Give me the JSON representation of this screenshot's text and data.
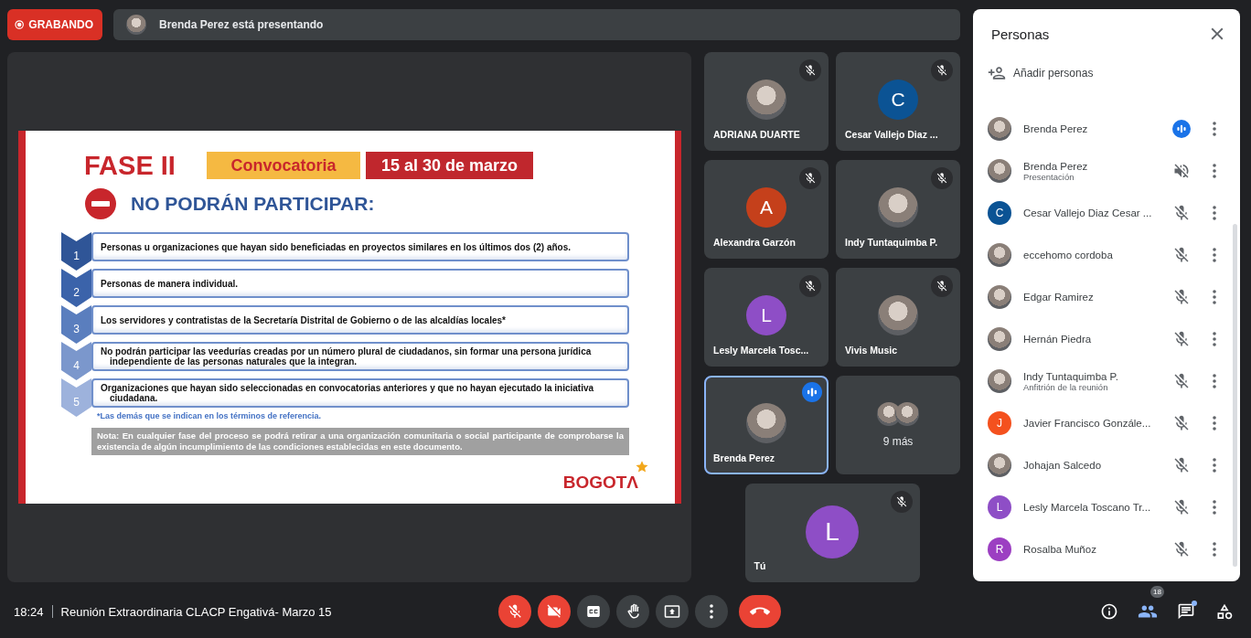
{
  "recording": {
    "label": "GRABANDO"
  },
  "presenting": {
    "text": "Brenda Perez está presentando"
  },
  "slide": {
    "phase": "FASE II",
    "tag": "Convocatoria",
    "date_range": "15 al 30 de marzo",
    "heading": "NO PODRÁN PARTICIPAR:",
    "items": [
      {
        "number": "1",
        "text": "Personas u organizaciones que hayan sido beneficiadas en proyectos similares en los últimos dos (2) años."
      },
      {
        "number": "2",
        "text": "Personas de manera individual."
      },
      {
        "number": "3",
        "text": "Los servidores y contratistas de la Secretaría Distrital de Gobierno o de las alcaldías locales*"
      },
      {
        "number": "4",
        "text": "No podrán participar las veedurías creadas por un número plural de ciudadanos, sin formar una persona jurídica independiente de las personas naturales que la integran."
      },
      {
        "number": "5",
        "text": "Organizaciones que hayan sido seleccionadas en convocatorias anteriores y que no hayan ejecutado la iniciativa ciudadana."
      }
    ],
    "footnote": "*Las demás que se indican en los términos de referencia.",
    "note": "Nota: En cualquier fase del proceso se podrá retirar a una organización comunitaria o social participante de comprobarse la existencia de algún incumplimiento de las condiciones establecidas en este documento.",
    "logo_text": "BOGOTΛ"
  },
  "tiles": [
    {
      "name": "ADRIANA DUARTE",
      "avatar": {
        "kind": "photo"
      },
      "muted": true,
      "speaking": false
    },
    {
      "name": "Cesar Vallejo Diaz ...",
      "avatar": {
        "kind": "letter",
        "letter": "C",
        "color": "#0b5394"
      },
      "muted": true,
      "speaking": false
    },
    {
      "name": "Alexandra Garzón",
      "avatar": {
        "kind": "letter",
        "letter": "A",
        "color": "#c5401b"
      },
      "muted": true,
      "speaking": false
    },
    {
      "name": "Indy Tuntaquimba P.",
      "avatar": {
        "kind": "photo"
      },
      "muted": true,
      "speaking": false
    },
    {
      "name": "Lesly Marcela Tosc...",
      "avatar": {
        "kind": "letter",
        "letter": "L",
        "color": "#8e4ec6"
      },
      "muted": true,
      "speaking": false
    },
    {
      "name": "Vivis Music",
      "avatar": {
        "kind": "photo"
      },
      "muted": true,
      "speaking": false
    },
    {
      "name": "Brenda Perez",
      "avatar": {
        "kind": "photo"
      },
      "muted": false,
      "speaking": true
    }
  ],
  "more_tile": {
    "label": "9 más"
  },
  "self_tile": {
    "name": "Tú",
    "letter": "L",
    "color": "#8e4ec6",
    "muted": true
  },
  "people_panel": {
    "title": "Personas",
    "add_label": "Añadir personas",
    "people": [
      {
        "name": "Brenda Perez",
        "avatar": {
          "kind": "photo"
        },
        "status": {
          "kind": "speaking"
        }
      },
      {
        "name": "Brenda Perez",
        "subtitle": "Presentación",
        "avatar": {
          "kind": "photo"
        },
        "status": {
          "kind": "speakeroff"
        }
      },
      {
        "name": "Cesar Vallejo Diaz Cesar ...",
        "avatar": {
          "kind": "letter",
          "letter": "C",
          "color": "#0b5394"
        },
        "status": {
          "kind": "muted"
        }
      },
      {
        "name": "eccehomo cordoba",
        "avatar": {
          "kind": "photo"
        },
        "status": {
          "kind": "muted"
        }
      },
      {
        "name": "Edgar Ramirez",
        "avatar": {
          "kind": "photo"
        },
        "status": {
          "kind": "muted"
        }
      },
      {
        "name": "Hernán Piedra",
        "avatar": {
          "kind": "photo"
        },
        "status": {
          "kind": "muted"
        }
      },
      {
        "name": "Indy Tuntaquimba P.",
        "subtitle": "Anfitrión de la reunión",
        "avatar": {
          "kind": "photo"
        },
        "status": {
          "kind": "muted"
        }
      },
      {
        "name": "Javier Francisco Gonzále...",
        "avatar": {
          "kind": "letter",
          "letter": "J",
          "color": "#f4511e"
        },
        "status": {
          "kind": "muted"
        }
      },
      {
        "name": "Johajan Salcedo",
        "avatar": {
          "kind": "photo"
        },
        "status": {
          "kind": "muted"
        }
      },
      {
        "name": "Lesly Marcela Toscano Tr...",
        "avatar": {
          "kind": "letter",
          "letter": "L",
          "color": "#8e4ec6"
        },
        "status": {
          "kind": "muted"
        }
      },
      {
        "name": "Rosalba Muñoz",
        "avatar": {
          "kind": "letter",
          "letter": "R",
          "color": "#9c3fc2"
        },
        "status": {
          "kind": "muted"
        }
      }
    ]
  },
  "bottom_bar": {
    "time": "18:24",
    "meeting_title": "Reunión Extraordinaria CLACP Engativá- Marzo 15",
    "controls": [
      {
        "kind": "mic",
        "off": true
      },
      {
        "kind": "camera",
        "off": true
      },
      {
        "kind": "captions"
      },
      {
        "kind": "hand"
      },
      {
        "kind": "present"
      },
      {
        "kind": "more"
      },
      {
        "kind": "leave"
      }
    ],
    "side_controls": [
      {
        "kind": "info"
      },
      {
        "kind": "people",
        "badge": "18"
      },
      {
        "kind": "chat",
        "unread": true
      },
      {
        "kind": "activities"
      }
    ]
  }
}
